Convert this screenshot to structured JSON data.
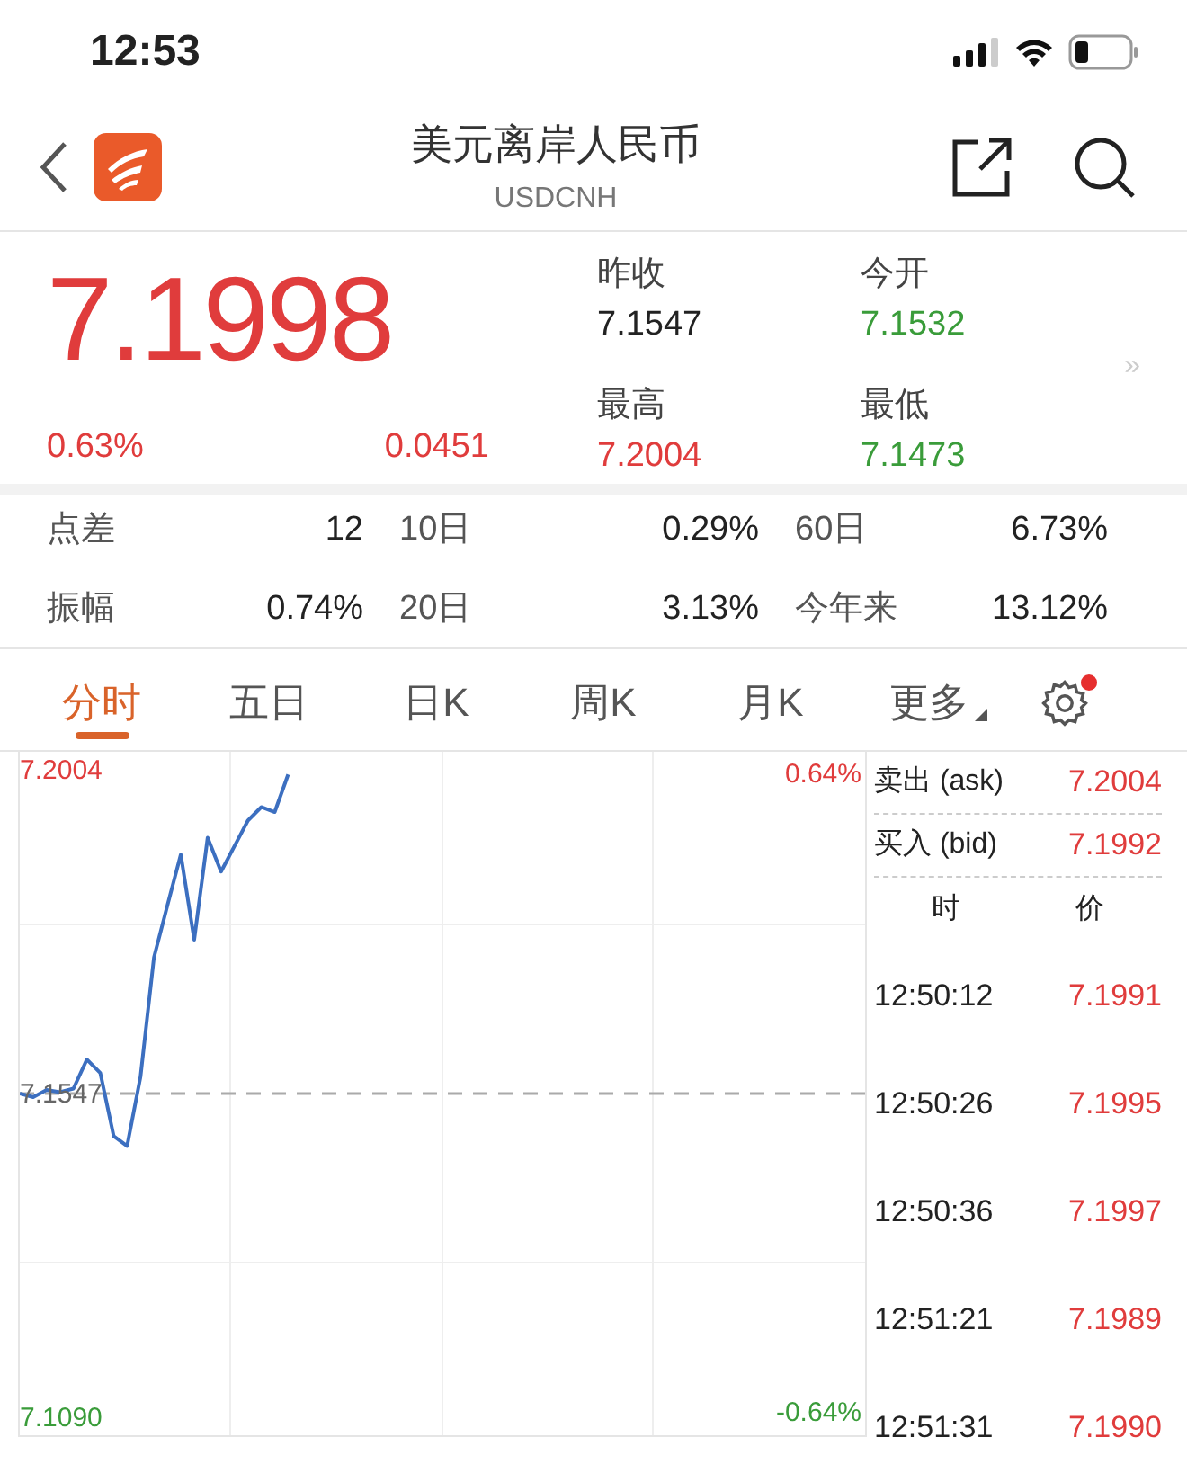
{
  "status_bar": {
    "time": "12:53"
  },
  "header": {
    "title": "美元离岸人民币",
    "subtitle": "USDCNH"
  },
  "quote": {
    "price": "7.1998",
    "change_pct": "0.63%",
    "change": "0.0451",
    "fields": [
      {
        "label": "昨收",
        "value": "7.1547",
        "color": "#222222"
      },
      {
        "label": "今开",
        "value": "7.1532",
        "color": "#3a9c3a"
      },
      {
        "label": "最高",
        "value": "7.2004",
        "color": "#e03c3c"
      },
      {
        "label": "最低",
        "value": "7.1473",
        "color": "#3a9c3a"
      }
    ],
    "more_indicator": "»"
  },
  "stats": [
    {
      "label": "点差",
      "value": "12"
    },
    {
      "label": "10日",
      "value": "0.29%"
    },
    {
      "label": "60日",
      "value": "6.73%"
    },
    {
      "label": "振幅",
      "value": "0.74%"
    },
    {
      "label": "20日",
      "value": "3.13%"
    },
    {
      "label": "今年来",
      "value": "13.12%"
    }
  ],
  "tabs": [
    {
      "label": "分时",
      "selected": true,
      "dropdown": false
    },
    {
      "label": "五日",
      "selected": false,
      "dropdown": false
    },
    {
      "label": "日K",
      "selected": false,
      "dropdown": false
    },
    {
      "label": "周K",
      "selected": false,
      "dropdown": false
    },
    {
      "label": "月K",
      "selected": false,
      "dropdown": false
    },
    {
      "label": "更多",
      "selected": false,
      "dropdown": true
    }
  ],
  "settings_badge": true,
  "chart": {
    "top_pct": "0.64%",
    "bottom_pct": "-0.64%",
    "chart_data": {
      "type": "line",
      "ylim": [
        7.1065,
        7.2029
      ],
      "yticks": [
        {
          "value": 7.2004,
          "label": "7.2004"
        },
        {
          "value": 7.1547,
          "label": "7.1547"
        },
        {
          "value": 7.109,
          "label": "7.1090"
        }
      ],
      "series": [
        {
          "color": "#3c6fc0",
          "line_style": "solid",
          "values": [
            7.1547,
            7.1542,
            7.1552,
            7.1549,
            7.1554,
            7.1595,
            7.1576,
            7.1487,
            7.1473,
            7.1571,
            7.1739,
            7.1812,
            7.1884,
            7.1764,
            7.1908,
            7.186,
            7.1896,
            7.1932,
            7.1951,
            7.1944,
            7.1997,
            null,
            null,
            null,
            null,
            null,
            null,
            null,
            null,
            null,
            null,
            null,
            null,
            null,
            null,
            null,
            null,
            null,
            null,
            null,
            null,
            null,
            null,
            null,
            null,
            null,
            null,
            null,
            null,
            null,
            null,
            null,
            null,
            null,
            null,
            null,
            null,
            null,
            null,
            null,
            null,
            null,
            null,
            null
          ]
        },
        {
          "color": "#aaaaaa",
          "line_style": "dashed",
          "values": [
            7.1547,
            7.1547,
            7.1547,
            7.1547,
            7.1547,
            7.1547,
            7.1547,
            7.1547,
            7.1547,
            7.1547,
            7.1547,
            7.1547,
            7.1547,
            7.1547,
            7.1547,
            7.1547,
            7.1547,
            7.1547,
            7.1547,
            7.1547,
            7.1547,
            7.1547,
            7.1547,
            7.1547,
            7.1547,
            7.1547,
            7.1547,
            7.1547,
            7.1547,
            7.1547,
            7.1547,
            7.1547,
            7.1547,
            7.1547,
            7.1547,
            7.1547,
            7.1547,
            7.1547,
            7.1547,
            7.1547,
            7.1547,
            7.1547,
            7.1547,
            7.1547,
            7.1547,
            7.1547,
            7.1547,
            7.1547,
            7.1547,
            7.1547,
            7.1547,
            7.1547,
            7.1547,
            7.1547,
            7.1547,
            7.1547,
            7.1547,
            7.1547,
            7.1547,
            7.1547,
            7.1547,
            7.1547,
            7.1547,
            7.1547
          ]
        }
      ]
    }
  },
  "order_book": [
    {
      "label": "卖出 (ask)",
      "value": "7.2004"
    },
    {
      "label": "买入 (bid)",
      "value": "7.1992"
    }
  ],
  "trades_header": {
    "time": "时",
    "price": "价"
  },
  "trades": [
    {
      "time": "12:50:12",
      "price": "7.1991"
    },
    {
      "time": "12:50:26",
      "price": "7.1995"
    },
    {
      "time": "12:50:36",
      "price": "7.1997"
    },
    {
      "time": "12:51:21",
      "price": "7.1989"
    },
    {
      "time": "12:51:31",
      "price": "7.1990"
    }
  ]
}
